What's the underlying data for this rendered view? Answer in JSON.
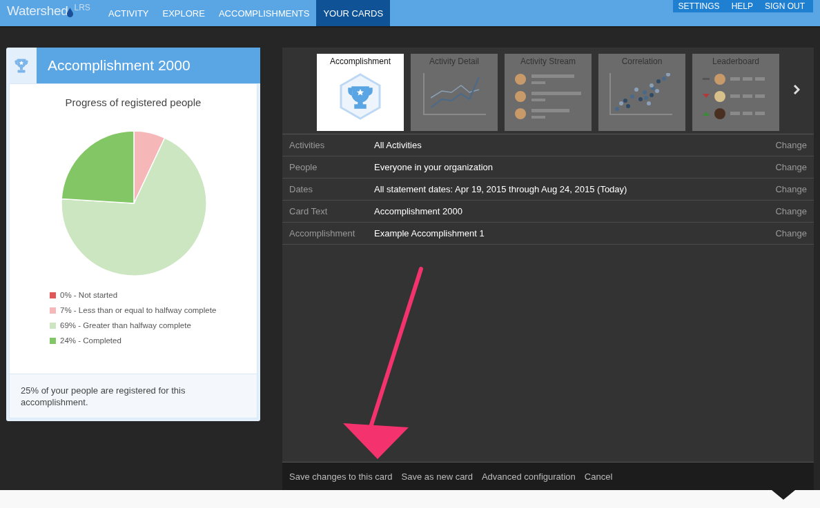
{
  "app": {
    "logo": "Watershed",
    "logo_suffix": "LRS"
  },
  "nav": [
    {
      "label": "ACTIVITY",
      "selected": false
    },
    {
      "label": "EXPLORE",
      "selected": false
    },
    {
      "label": "ACCOMPLISHMENTS",
      "selected": false
    },
    {
      "label": "YOUR CARDS",
      "selected": true
    }
  ],
  "user_menu": [
    "SETTINGS",
    "HELP",
    "SIGN OUT"
  ],
  "card": {
    "title": "Accomplishment 2000",
    "chart_data": {
      "type": "pie",
      "title": "Progress of registered people",
      "categories": [
        "0% - Not started",
        "7% - Less than or equal to halfway complete",
        "69% - Greater than halfway complete",
        "24% - Completed"
      ],
      "values": [
        0,
        7,
        69,
        24
      ],
      "colors": [
        "#e05858",
        "#f5b7b7",
        "#cbe6c0",
        "#82c665"
      ]
    },
    "summary": "25% of your people are registered for this accomplishment."
  },
  "card_types": [
    {
      "label": "Accomplishment",
      "kind": "accomplishment",
      "selected": true
    },
    {
      "label": "Activity Detail",
      "kind": "line",
      "selected": false
    },
    {
      "label": "Activity Stream",
      "kind": "stream",
      "selected": false
    },
    {
      "label": "Correlation",
      "kind": "scatter",
      "selected": false
    },
    {
      "label": "Leaderboard",
      "kind": "leaderboard",
      "selected": false
    }
  ],
  "settings": [
    {
      "label": "Activities",
      "value": "All Activities",
      "action": "Change"
    },
    {
      "label": "People",
      "value": "Everyone in your organization",
      "action": "Change"
    },
    {
      "label": "Dates",
      "value": "All statement dates: Apr 19, 2015 through Aug 24, 2015 (Today)",
      "action": "Change"
    },
    {
      "label": "Card Text",
      "value": "Accomplishment 2000",
      "action": "Change"
    },
    {
      "label": "Accomplishment",
      "value": "Example Accomplishment 1",
      "action": "Change"
    }
  ],
  "footer_actions": [
    "Save changes to this card",
    "Save as new card",
    "Advanced configuration",
    "Cancel"
  ]
}
